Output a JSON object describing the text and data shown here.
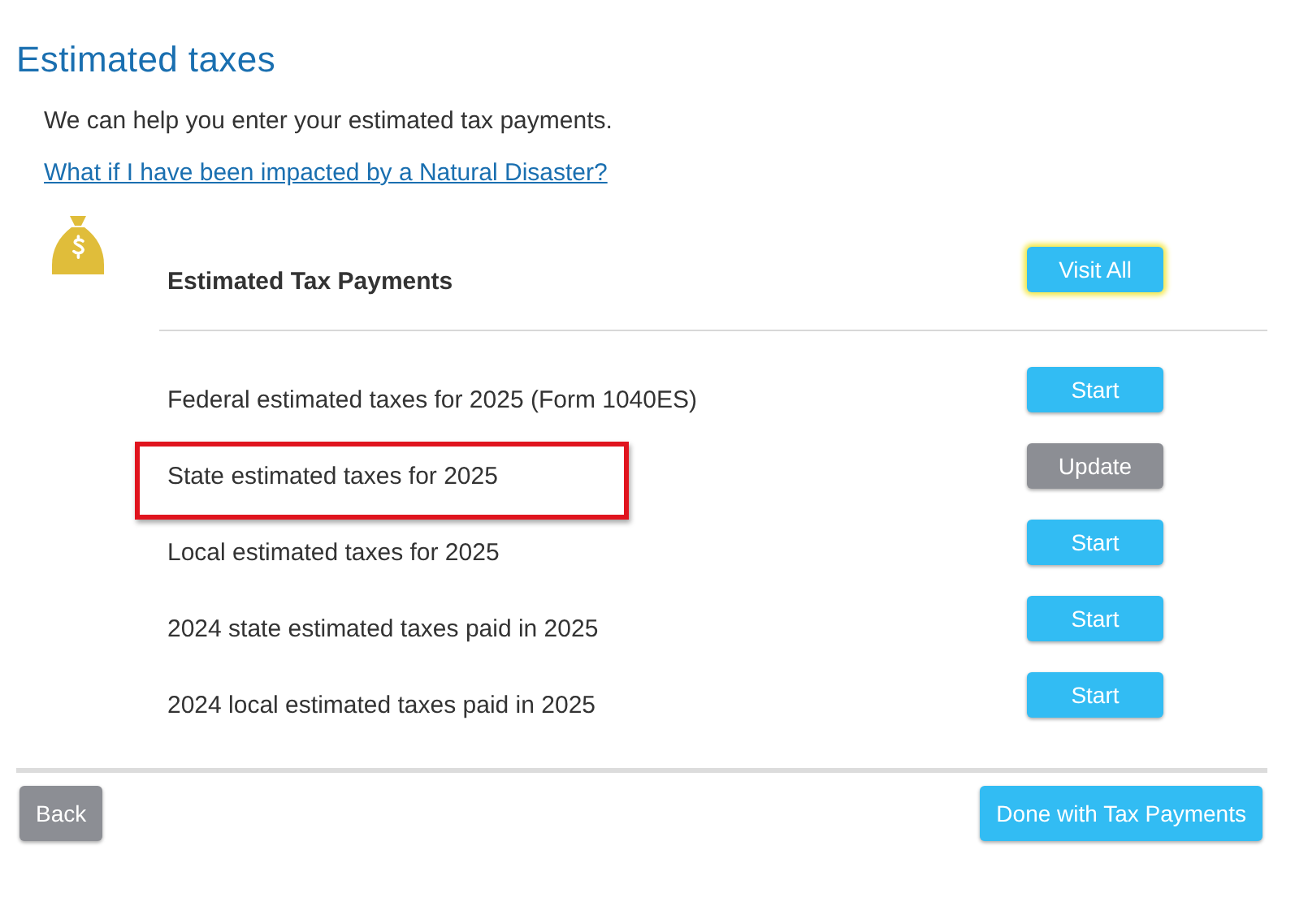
{
  "title": "Estimated taxes",
  "intro": "We can help you enter your estimated tax payments.",
  "link": "What if I have been impacted by a Natural Disaster?",
  "section": {
    "title": "Estimated Tax Payments",
    "button": {
      "label": "Visit All",
      "focused": true
    }
  },
  "items": [
    {
      "label": "Federal estimated taxes for 2025 (Form 1040ES)",
      "button": {
        "label": "Start",
        "kind": "start"
      },
      "highlighted": false
    },
    {
      "label": "State estimated taxes for 2025",
      "button": {
        "label": "Update",
        "kind": "update"
      },
      "highlighted": true
    },
    {
      "label": "Local estimated taxes for 2025",
      "button": {
        "label": "Start",
        "kind": "start"
      },
      "highlighted": false
    },
    {
      "label": "2024 state estimated taxes paid in 2025",
      "button": {
        "label": "Start",
        "kind": "start"
      },
      "highlighted": false
    },
    {
      "label": "2024 local estimated taxes paid in 2025",
      "button": {
        "label": "Start",
        "kind": "start"
      },
      "highlighted": false
    }
  ],
  "footer": {
    "back": "Back",
    "done": "Done with Tax Payments"
  }
}
